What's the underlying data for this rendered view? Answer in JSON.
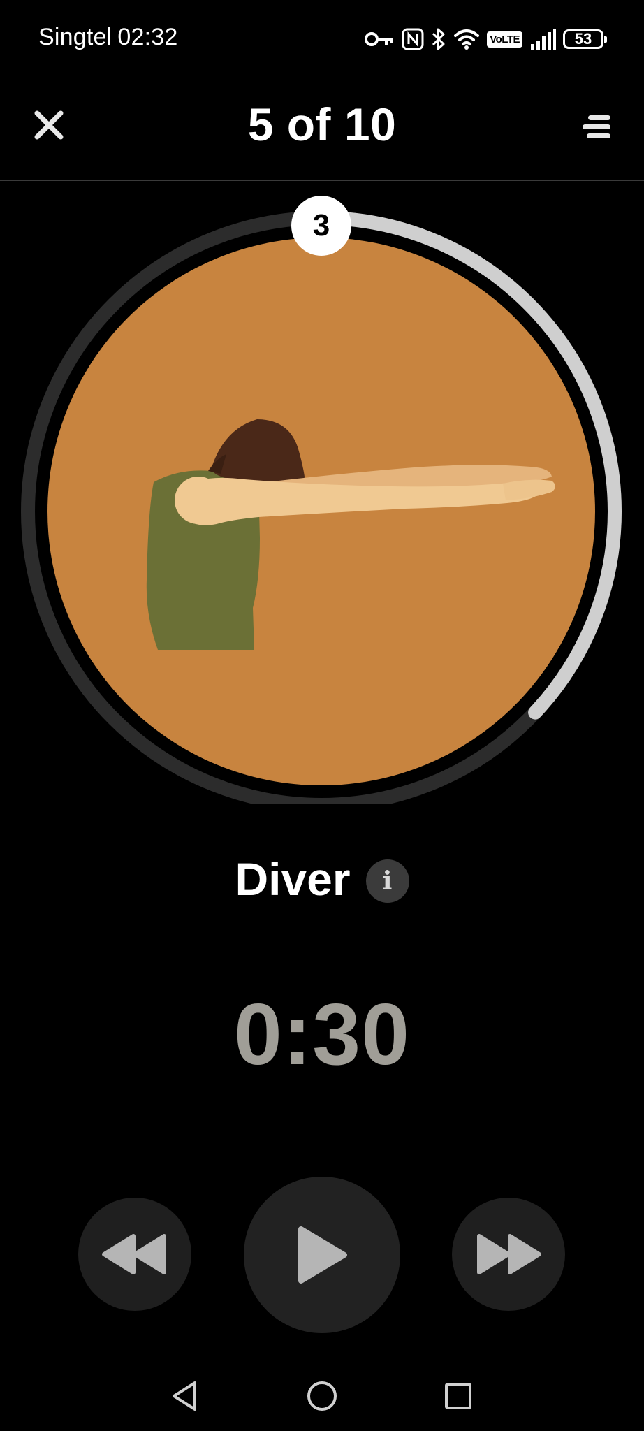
{
  "status_bar": {
    "carrier": "Singtel",
    "time": "02:32",
    "volte_label": "VoLTE",
    "battery_level": "53"
  },
  "header": {
    "title": "5 of 10"
  },
  "exercise": {
    "count": "3",
    "name": "Diver",
    "timer": "0:30",
    "progress_fraction": 0.37,
    "illustration_background": "#c8843f",
    "ring_track_color": "#2c2c2c",
    "ring_progress_color": "#cfcfcf"
  },
  "controls": {
    "rewind_icon": "rewind-icon",
    "play_icon": "play-icon",
    "fast_forward_icon": "fast-forward-icon"
  },
  "nav": {
    "back_icon": "back-triangle-icon",
    "home_icon": "home-circle-icon",
    "recents_icon": "recents-square-icon"
  }
}
